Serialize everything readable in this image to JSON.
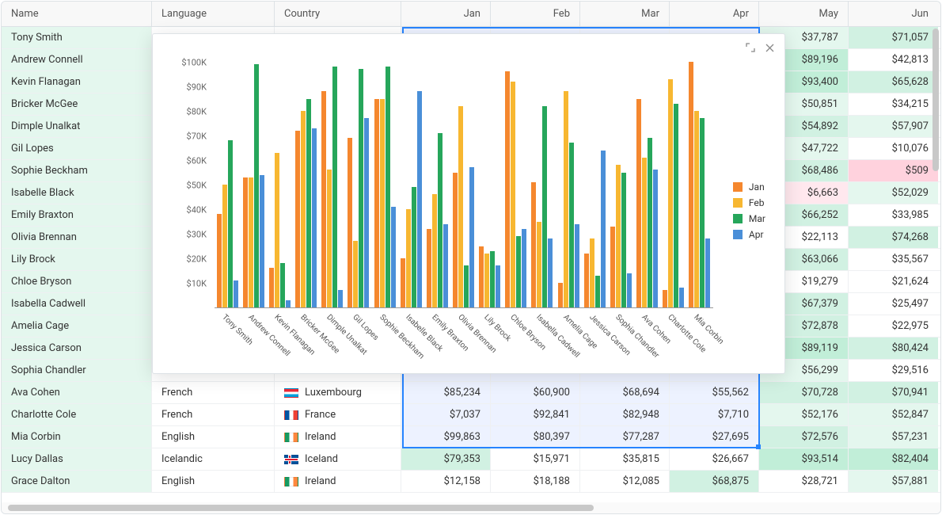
{
  "columns": {
    "name": "Name",
    "language": "Language",
    "country": "Country",
    "jan": "Jan",
    "feb": "Feb",
    "mar": "Mar",
    "apr": "Apr",
    "may": "May",
    "jun": "Jun"
  },
  "widths": {
    "name": 190,
    "language": 155,
    "country": 160,
    "month": 113
  },
  "heat": {
    "g1": "#e4f7ee",
    "g2": "#d1f1e2",
    "g3": "#c1eed8",
    "r1": "#ffe8ee",
    "r2": "#ffd2dd",
    "w": "#ffffff"
  },
  "flags": {
    "Luxembourg": [
      "#ed2939",
      "#ffffff",
      "#00a1de"
    ],
    "France": [
      "#0055a4",
      "#ffffff",
      "#ef4135"
    ],
    "Ireland": [
      "#169b62",
      "#ffffff",
      "#ff883e"
    ],
    "Iceland": [
      "#02529c",
      "#ffffff",
      "#dc1e35"
    ]
  },
  "rows": [
    {
      "name": "Tony Smith",
      "language": "",
      "country": "",
      "mayVal": "$37,787",
      "mayBg": "g1",
      "junVal": "$71,057",
      "junBg": "g2"
    },
    {
      "name": "Andrew Connell",
      "language": "",
      "country": "",
      "mayVal": "$89,196",
      "mayBg": "g3",
      "junVal": "$42,813",
      "junBg": "w"
    },
    {
      "name": "Kevin Flanagan",
      "language": "",
      "country": "",
      "mayVal": "$93,400",
      "mayBg": "g3",
      "junVal": "$65,628",
      "junBg": "g2"
    },
    {
      "name": "Bricker McGee",
      "language": "",
      "country": "",
      "mayVal": "$50,851",
      "mayBg": "g1",
      "junVal": "$34,215",
      "junBg": "w"
    },
    {
      "name": "Dimple Unalkat",
      "language": "",
      "country": "",
      "mayVal": "$54,892",
      "mayBg": "g2",
      "junVal": "$57,907",
      "junBg": "g1"
    },
    {
      "name": "Gil Lopes",
      "language": "",
      "country": "",
      "mayVal": "$47,722",
      "mayBg": "g1",
      "junVal": "$10,076",
      "junBg": "w"
    },
    {
      "name": "Sophie Beckham",
      "language": "",
      "country": "",
      "mayVal": "$68,486",
      "mayBg": "g2",
      "junVal": "$509",
      "junBg": "r2"
    },
    {
      "name": "Isabelle Black",
      "language": "",
      "country": "",
      "mayVal": "$6,663",
      "mayBg": "r1",
      "junVal": "$52,029",
      "junBg": "g1"
    },
    {
      "name": "Emily Braxton",
      "language": "",
      "country": "",
      "mayVal": "$66,252",
      "mayBg": "g2",
      "junVal": "$33,985",
      "junBg": "w"
    },
    {
      "name": "Olivia Brennan",
      "language": "",
      "country": "",
      "mayVal": "$22,113",
      "mayBg": "w",
      "junVal": "$74,268",
      "junBg": "g2"
    },
    {
      "name": "Lily Brock",
      "language": "",
      "country": "",
      "mayVal": "$63,066",
      "mayBg": "g2",
      "junVal": "$35,567",
      "junBg": "w"
    },
    {
      "name": "Chloe Bryson",
      "language": "",
      "country": "",
      "mayVal": "$19,279",
      "mayBg": "w",
      "junVal": "$21,624",
      "junBg": "w"
    },
    {
      "name": "Isabella Cadwell",
      "language": "",
      "country": "",
      "mayVal": "$67,379",
      "mayBg": "g2",
      "junVal": "$25,497",
      "junBg": "w"
    },
    {
      "name": "Amelia Cage",
      "language": "",
      "country": "",
      "mayVal": "$72,878",
      "mayBg": "g2",
      "junVal": "$22,975",
      "junBg": "w"
    },
    {
      "name": "Jessica Carson",
      "language": "",
      "country": "",
      "mayVal": "$89,119",
      "mayBg": "g3",
      "junVal": "$80,424",
      "junBg": "g2"
    },
    {
      "name": "Sophia Chandler",
      "language": "",
      "country": "",
      "mayVal": "$56,299",
      "mayBg": "g1",
      "junVal": "$29,516",
      "junBg": "w"
    },
    {
      "name": "Ava Cohen",
      "language": "French",
      "country": "Luxembourg",
      "janVal": "$85,234",
      "febVal": "$60,900",
      "marVal": "$68,694",
      "aprVal": "$55,562",
      "mayVal": "$70,728",
      "mayBg": "g2",
      "junVal": "$70,941",
      "junBg": "g2"
    },
    {
      "name": "Charlotte Cole",
      "language": "French",
      "country": "France",
      "janVal": "$7,037",
      "febVal": "$92,841",
      "marVal": "$82,948",
      "aprVal": "$7,710",
      "mayVal": "$52,176",
      "mayBg": "g1",
      "junVal": "$52,847",
      "junBg": "g1"
    },
    {
      "name": "Mia Corbin",
      "language": "English",
      "country": "Ireland",
      "janVal": "$99,863",
      "febVal": "$80,397",
      "marVal": "$77,287",
      "aprVal": "$27,695",
      "mayVal": "$72,576",
      "mayBg": "g2",
      "junVal": "$57,231",
      "junBg": "g1"
    },
    {
      "name": "Lucy Dallas",
      "language": "Icelandic",
      "country": "Iceland",
      "janVal": "$79,353",
      "janBg": "g2",
      "febVal": "$15,971",
      "marVal": "$35,815",
      "aprVal": "$26,667",
      "mayVal": "$93,514",
      "mayBg": "g3",
      "junVal": "$82,404",
      "junBg": "g3"
    },
    {
      "name": "Grace Dalton",
      "language": "English",
      "country": "Ireland",
      "janVal": "$12,158",
      "febVal": "$18,188",
      "marVal": "$12,085",
      "aprVal": "$68,875",
      "aprBg": "g2",
      "mayVal": "$28,721",
      "mayBg": "w",
      "junVal": "$57,881",
      "junBg": "g1"
    }
  ],
  "selection": {
    "startRow": 0,
    "endRow": 18,
    "label": "Jan–Apr × 19 rows"
  },
  "chart_data": {
    "type": "bar",
    "title": "",
    "ylabel": "",
    "ylim": [
      0,
      100000
    ],
    "yticks": [
      "$10K",
      "$20K",
      "$30K",
      "$40K",
      "$50K",
      "$60K",
      "$70K",
      "$80K",
      "$90K",
      "$100K"
    ],
    "categories": [
      "Tony Smith",
      "Andrew Connell",
      "Kevin Flanagan",
      "Bricker McGee",
      "Dimple Unalkat",
      "Gil Lopes",
      "Sophie Beckham",
      "Isabelle Black",
      "Emily Braxton",
      "Olivia Brennan",
      "Lily Brock",
      "Chloe Bryson",
      "Isabella Cadwell",
      "Amelia Cage",
      "Jessica Carson",
      "Sophia Chandler",
      "Ava Cohen",
      "Charlotte Cole",
      "Mia Corbin"
    ],
    "series": [
      {
        "name": "Jan",
        "color": "#f5872e",
        "values": [
          38000,
          53000,
          16000,
          72000,
          88000,
          69000,
          85000,
          20000,
          32000,
          55000,
          25000,
          96000,
          51000,
          10000,
          22000,
          33000,
          85000,
          7000,
          100000
        ]
      },
      {
        "name": "Feb",
        "color": "#f7b731",
        "values": [
          50000,
          53000,
          63000,
          80000,
          56000,
          27000,
          85000,
          40000,
          46000,
          82000,
          22000,
          92000,
          35000,
          88000,
          28000,
          58000,
          61000,
          93000,
          80000
        ]
      },
      {
        "name": "Mar",
        "color": "#26a65b",
        "values": [
          68000,
          99000,
          18000,
          85000,
          98000,
          97000,
          98000,
          49000,
          71000,
          17000,
          23000,
          29000,
          82000,
          67000,
          13000,
          55000,
          69000,
          83000,
          77000
        ]
      },
      {
        "name": "Apr",
        "color": "#4a8fd8",
        "values": [
          11000,
          54000,
          3000,
          73000,
          7000,
          77000,
          41000,
          88000,
          34000,
          57000,
          17000,
          32000,
          28000,
          34000,
          64000,
          14000,
          56000,
          8000,
          28000
        ]
      }
    ],
    "legend": [
      "Jan",
      "Feb",
      "Mar",
      "Apr"
    ]
  },
  "popup_controls": {
    "expand": "expand",
    "close": "close"
  }
}
